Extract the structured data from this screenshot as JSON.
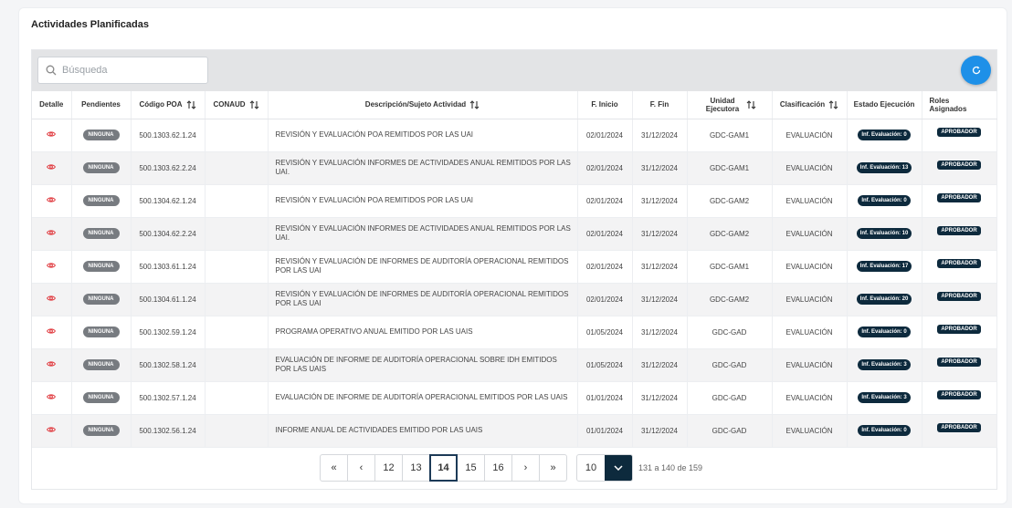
{
  "card": {
    "title": "Actividades Planificadas"
  },
  "search": {
    "placeholder": "Búsqueda"
  },
  "columns": {
    "detalle": "Detalle",
    "pendientes": "Pendientes",
    "codigo": "Código POA",
    "conaud": "CONAUD",
    "descripcion": "Descripción/Sujeto Actividad",
    "inicio": "F. Inicio",
    "fin": "F. Fin",
    "unidad": "Unidad Ejecutora",
    "clasificacion": "Clasificación",
    "estado": "Estado Ejecución",
    "roles": "Roles Asignados"
  },
  "icons": {
    "search": "search-icon",
    "refresh": "refresh-icon",
    "detail": "eye-icon",
    "sort": "sort-icon"
  },
  "colors": {
    "accent": "#1e90e8",
    "dark_badge": "#0d2a3d",
    "gray_badge": "#777b80",
    "eye": "#e0393e"
  },
  "rows": [
    {
      "pend": "NINGUNA",
      "codigo": "500.1303.62.1.24",
      "conaud": "",
      "desc": "REVISIÓN Y EVALUACIÓN POA REMITIDOS POR LAS UAI",
      "inicio": "02/01/2024",
      "fin": "31/12/2024",
      "unidad": "GDC-GAM1",
      "clas": "EVALUACIÓN",
      "estado": "Inf. Evaluación: 0",
      "rol": "APROBADOR"
    },
    {
      "pend": "NINGUNA",
      "codigo": "500.1303.62.2.24",
      "conaud": "",
      "desc": "REVISIÓN Y EVALUACIÓN INFORMES DE ACTIVIDADES ANUAL REMITIDOS POR LAS UAI.",
      "inicio": "02/01/2024",
      "fin": "31/12/2024",
      "unidad": "GDC-GAM1",
      "clas": "EVALUACIÓN",
      "estado": "Inf. Evaluación: 13",
      "rol": "APROBADOR"
    },
    {
      "pend": "NINGUNA",
      "codigo": "500.1304.62.1.24",
      "conaud": "",
      "desc": "REVISIÓN Y EVALUACIÓN POA REMITIDOS POR LAS UAI",
      "inicio": "02/01/2024",
      "fin": "31/12/2024",
      "unidad": "GDC-GAM2",
      "clas": "EVALUACIÓN",
      "estado": "Inf. Evaluación: 0",
      "rol": "APROBADOR"
    },
    {
      "pend": "NINGUNA",
      "codigo": "500.1304.62.2.24",
      "conaud": "",
      "desc": "REVISIÓN Y EVALUACIÓN INFORMES DE ACTIVIDADES ANUAL REMITIDOS POR LAS UAI.",
      "inicio": "02/01/2024",
      "fin": "31/12/2024",
      "unidad": "GDC-GAM2",
      "clas": "EVALUACIÓN",
      "estado": "Inf. Evaluación: 10",
      "rol": "APROBADOR"
    },
    {
      "pend": "NINGUNA",
      "codigo": "500.1303.61.1.24",
      "conaud": "",
      "desc": "REVISIÓN Y EVALUACIÓN DE INFORMES DE AUDITORÍA OPERACIONAL REMITIDOS POR LAS UAI",
      "inicio": "02/01/2024",
      "fin": "31/12/2024",
      "unidad": "GDC-GAM1",
      "clas": "EVALUACIÓN",
      "estado": "Inf. Evaluación: 17",
      "rol": "APROBADOR"
    },
    {
      "pend": "NINGUNA",
      "codigo": "500.1304.61.1.24",
      "conaud": "",
      "desc": "REVISIÓN Y EVALUACIÓN DE INFORMES DE AUDITORÍA OPERACIONAL REMITIDOS POR LAS UAI",
      "inicio": "02/01/2024",
      "fin": "31/12/2024",
      "unidad": "GDC-GAM2",
      "clas": "EVALUACIÓN",
      "estado": "Inf. Evaluación: 20",
      "rol": "APROBADOR"
    },
    {
      "pend": "NINGUNA",
      "codigo": "500.1302.59.1.24",
      "conaud": "",
      "desc": "PROGRAMA OPERATIVO ANUAL EMITIDO POR LAS UAIS",
      "inicio": "01/05/2024",
      "fin": "31/12/2024",
      "unidad": "GDC-GAD",
      "clas": "EVALUACIÓN",
      "estado": "Inf. Evaluación: 0",
      "rol": "APROBADOR"
    },
    {
      "pend": "NINGUNA",
      "codigo": "500.1302.58.1.24",
      "conaud": "",
      "desc": "EVALUACIÓN DE INFORME DE AUDITORÍA OPERACIONAL SOBRE IDH EMITIDOS POR LAS UAIS",
      "inicio": "01/05/2024",
      "fin": "31/12/2024",
      "unidad": "GDC-GAD",
      "clas": "EVALUACIÓN",
      "estado": "Inf. Evaluación: 3",
      "rol": "APROBADOR"
    },
    {
      "pend": "NINGUNA",
      "codigo": "500.1302.57.1.24",
      "conaud": "",
      "desc": "EVALUACIÓN DE INFORME DE AUDITORÍA OPERACIONAL EMITIDOS POR LAS UAIS",
      "inicio": "01/01/2024",
      "fin": "31/12/2024",
      "unidad": "GDC-GAD",
      "clas": "EVALUACIÓN",
      "estado": "Inf. Evaluación: 3",
      "rol": "APROBADOR"
    },
    {
      "pend": "NINGUNA",
      "codigo": "500.1302.56.1.24",
      "conaud": "",
      "desc": "INFORME ANUAL DE ACTIVIDADES EMITIDO POR LAS UAIS",
      "inicio": "01/01/2024",
      "fin": "31/12/2024",
      "unidad": "GDC-GAD",
      "clas": "EVALUACIÓN",
      "estado": "Inf. Evaluación: 0",
      "rol": "APROBADOR"
    }
  ],
  "pagination": {
    "first": "«",
    "prev": "‹",
    "pages": [
      "12",
      "13",
      "14",
      "15",
      "16"
    ],
    "current_page": "14",
    "next": "›",
    "last": "»",
    "page_size": "10",
    "range_text": "131 a 140 de 159"
  }
}
